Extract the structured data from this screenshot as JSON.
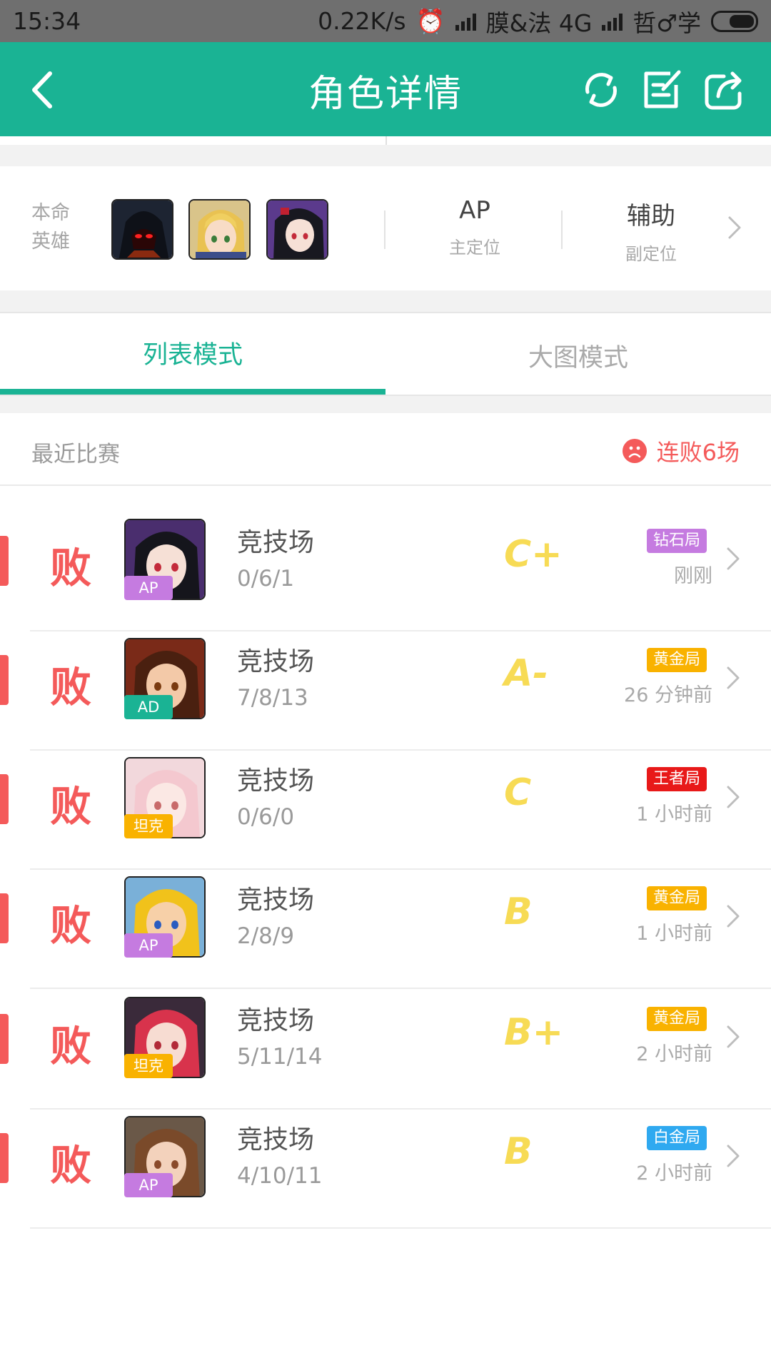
{
  "status_bar": {
    "time": "15:34",
    "net_speed": "0.22K/s",
    "carrier1": "膜&法 4G",
    "carrier2": "哲♂学"
  },
  "header": {
    "title": "角色详情",
    "icons": [
      "back-arrow-icon",
      "refresh-icon",
      "edit-icon",
      "share-icon"
    ]
  },
  "hero_card": {
    "label": "本命英雄",
    "primary_position_value": "AP",
    "primary_position_label": "主定位",
    "secondary_position_value": "辅助",
    "secondary_position_label": "副定位"
  },
  "tabs": [
    {
      "label": "列表模式",
      "active": true
    },
    {
      "label": "大图模式",
      "active": false
    }
  ],
  "recent": {
    "title": "最近比赛",
    "streak": "连败6场"
  },
  "matches": [
    {
      "result": "败",
      "role": "AP",
      "role_color": "#c57be0",
      "mode": "竞技场",
      "kda": "0/6/1",
      "grade": "C+",
      "rank": "钻石局",
      "rank_color": "#c57be0",
      "time": "刚刚"
    },
    {
      "result": "败",
      "role": "AD",
      "role_color": "#1ab394",
      "mode": "竞技场",
      "kda": "7/8/13",
      "grade": "A-",
      "rank": "黄金局",
      "rank_color": "#f9b200",
      "time": "26 分钟前"
    },
    {
      "result": "败",
      "role": "坦克",
      "role_color": "#f9b200",
      "mode": "竞技场",
      "kda": "0/6/0",
      "grade": "C",
      "rank": "王者局",
      "rank_color": "#e81919",
      "time": "1 小时前"
    },
    {
      "result": "败",
      "role": "AP",
      "role_color": "#c57be0",
      "mode": "竞技场",
      "kda": "2/8/9",
      "grade": "B",
      "rank": "黄金局",
      "rank_color": "#f9b200",
      "time": "1 小时前"
    },
    {
      "result": "败",
      "role": "坦克",
      "role_color": "#f9b200",
      "mode": "竞技场",
      "kda": "5/11/14",
      "grade": "B+",
      "rank": "黄金局",
      "rank_color": "#f9b200",
      "time": "2 小时前"
    },
    {
      "result": "败",
      "role": "AP",
      "role_color": "#c57be0",
      "mode": "竞技场",
      "kda": "4/10/11",
      "grade": "B",
      "rank": "白金局",
      "rank_color": "#2fa9f0",
      "time": "2 小时前"
    }
  ]
}
